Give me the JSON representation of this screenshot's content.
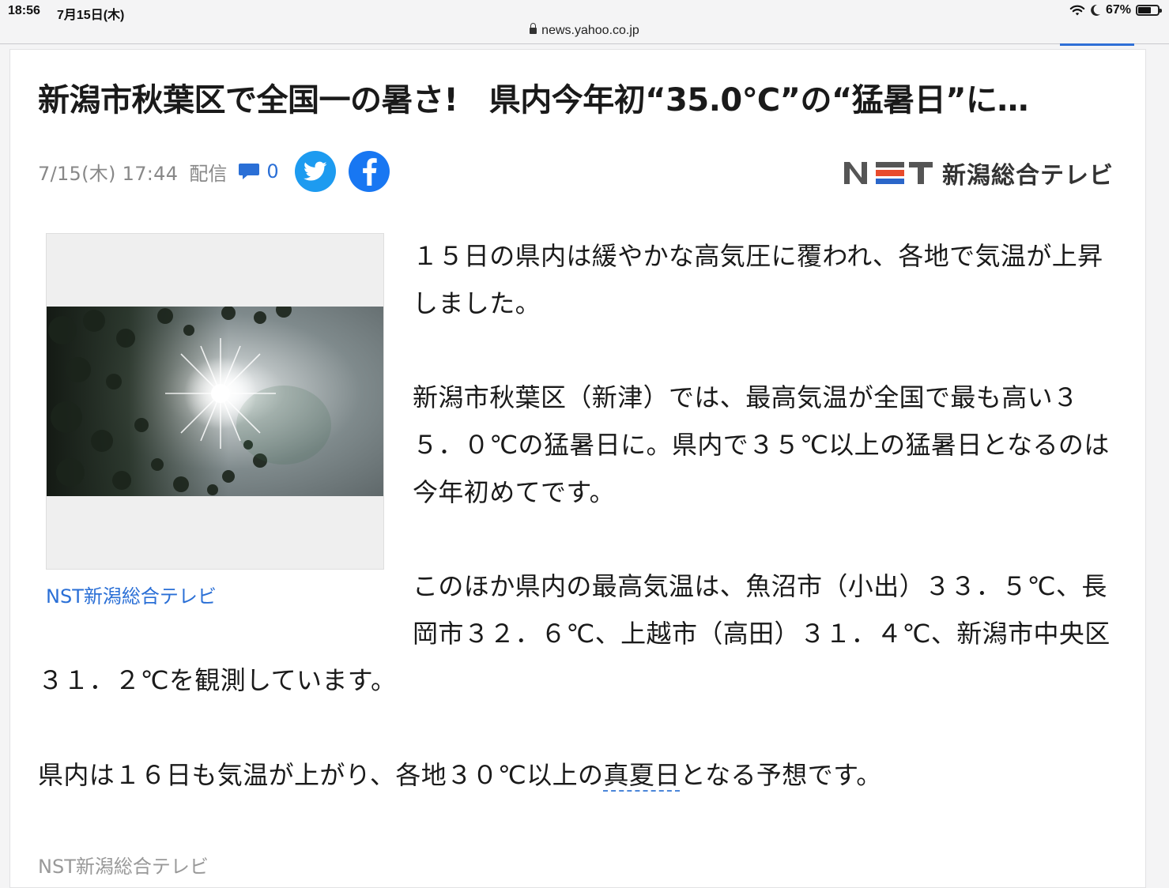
{
  "status_bar": {
    "time": "18:56",
    "date": "7月15日(木)",
    "battery_percent_text": "67%",
    "battery_level": 0.67
  },
  "browser": {
    "url": "news.yahoo.co.jp"
  },
  "article": {
    "title": "新潟市秋葉区で全国一の暑さ!　県内今年初“35.0℃”の“猛暑日”に…",
    "published": "7/15(木) 17:44",
    "published_label": "配信",
    "comment_count": "0",
    "brand_logo_letters": "NST",
    "brand_name": "新潟総合テレビ",
    "photo_caption": "NST新潟総合テレビ",
    "paragraphs": [
      "１５日の県内は緩やかな高気圧に覆われ、各地で気温が上昇しました。",
      "新潟市秋葉区（新津）では、最高気温が全国で最も高い３５．０℃の猛暑日に。県内で３５℃以上の猛暑日となるのは今年初めてです。",
      "このほか県内の最高気温は、魚沼市（小出）３３．５℃、長岡市３２．６℃、上越市（高田）３１．４℃、新潟市中央区３１．２℃を観測しています。"
    ],
    "last_paragraph": {
      "before": "県内は１６日も気温が上がり、各地３０℃以上の",
      "link": "真夏日",
      "after": "となる予想です。"
    },
    "source": "NST新潟総合テレビ"
  },
  "colors": {
    "link_blue": "#2a6fd6",
    "twitter_blue": "#1d9bf0",
    "facebook_blue": "#1877f2",
    "meta_gray": "#888888"
  },
  "icons": {
    "comment": "speech-bubble-icon",
    "twitter": "twitter-bird-icon",
    "facebook": "facebook-f-icon",
    "lock": "lock-icon",
    "wifi": "wifi-icon",
    "moon": "moon-icon",
    "battery": "battery-icon"
  }
}
